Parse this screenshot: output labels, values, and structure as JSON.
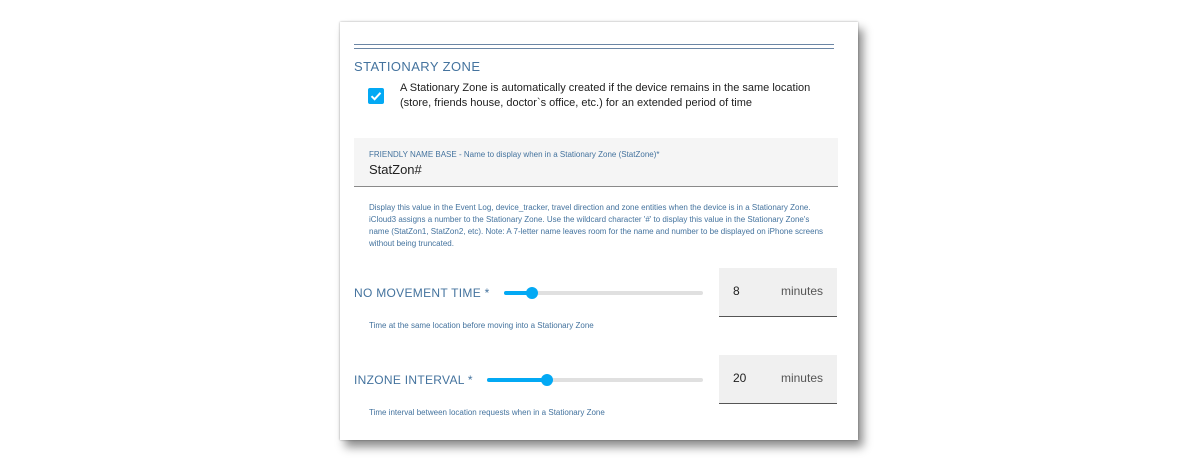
{
  "section": {
    "title": "STATIONARY ZONE",
    "checkbox": {
      "checked": true,
      "description": "A Stationary Zone is automatically created if the device remains in the same location (store, friends house, doctor`s office, etc.) for an extended period of time"
    }
  },
  "friendly_name": {
    "label": "FRIENDLY NAME BASE - Name to display when in a Stationary Zone (StatZone)*",
    "value": "StatZon#",
    "helper": "Display this value in the Event Log, device_tracker, travel direction and zone entities when the device is in a Stationary Zone. iCloud3 assigns a number to the Stationary Zone. Use the wildcard character '#' to display this value in the Stationary Zone's name (StatZon1, StatZon2, etc). Note: A 7-letter name leaves room for the name and number to be displayed on iPhone screens without being truncated."
  },
  "no_movement": {
    "label": "NO MOVEMENT TIME *",
    "value": "8",
    "unit": "minutes",
    "slider_fraction": 0.14,
    "helper": "Time at the same location before moving into a Stationary Zone"
  },
  "inzone_interval": {
    "label": "INZONE INTERVAL *",
    "value": "20",
    "unit": "minutes",
    "slider_fraction": 0.28,
    "helper": "Time interval between location requests when in a Stationary Zone"
  },
  "colors": {
    "accent": "#03a9f4",
    "label": "#44739e"
  },
  "icons": {
    "checkbox": "check-icon"
  }
}
